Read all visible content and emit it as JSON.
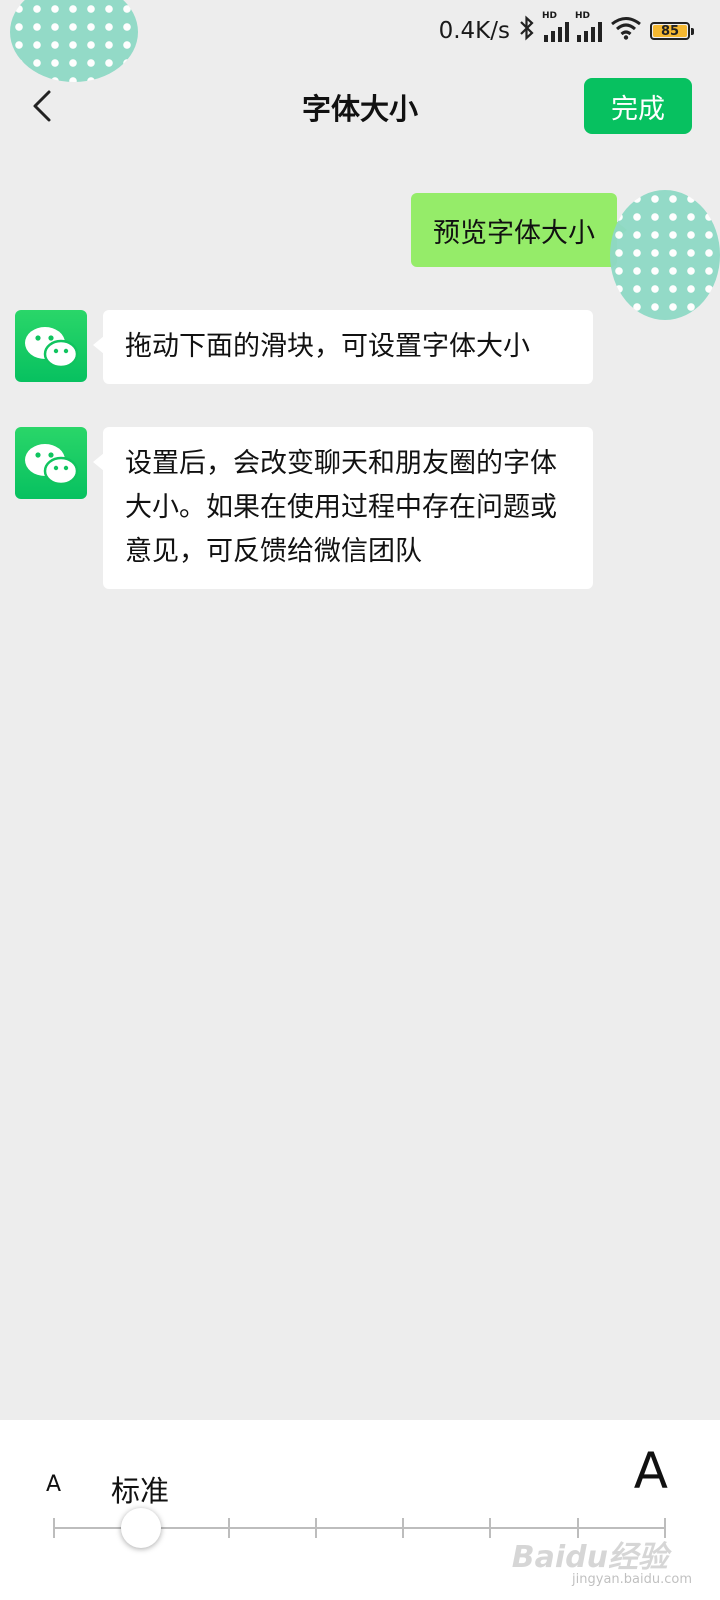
{
  "status_bar": {
    "net_speed": "0.4K/s",
    "signal_label": "HD",
    "battery_level": "85"
  },
  "nav": {
    "title": "字体大小",
    "done_label": "完成"
  },
  "chat": {
    "preview_message": "预览字体大小",
    "messages": [
      "拖动下面的滑块，可设置字体大小",
      "设置后，会改变聊天和朋友圈的字体大小。如果在使用过程中存在问题或意见，可反馈给微信团队"
    ]
  },
  "font_slider": {
    "small_label": "A",
    "large_label": "A",
    "current_label": "标准",
    "positions": 8,
    "selected_index": 1
  },
  "watermark": {
    "brand": "Baidu经验",
    "url": "jingyan.baidu.com"
  },
  "colors": {
    "accent": "#07c160",
    "self_bubble": "#95ec69",
    "background": "#ededed"
  }
}
